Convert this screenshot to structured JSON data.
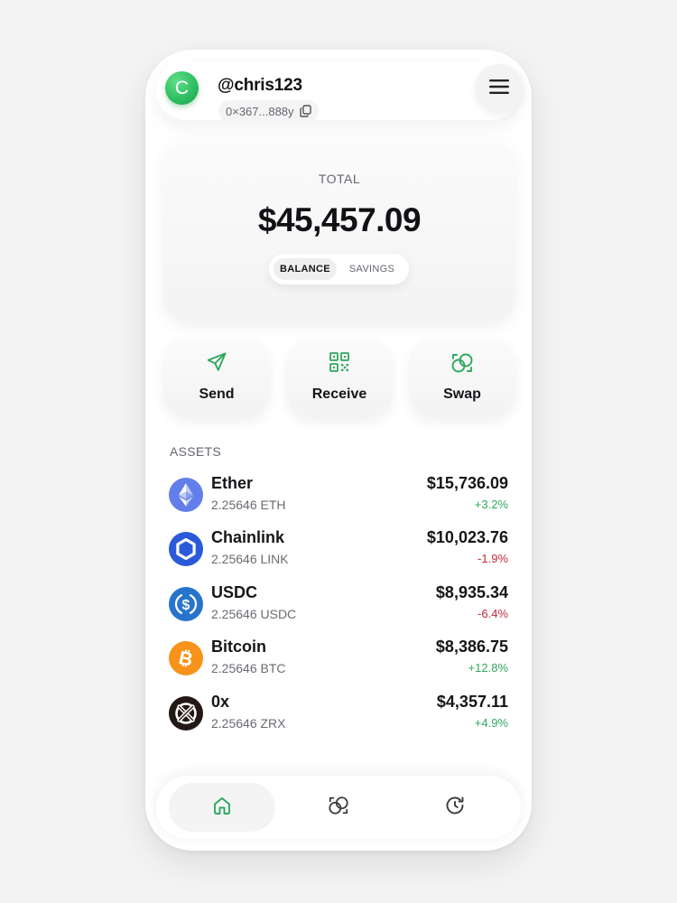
{
  "header": {
    "avatar_letter": "C",
    "username": "@chris123",
    "address": "0×367...888y"
  },
  "total": {
    "label": "TOTAL",
    "value": "$45,457.09",
    "tabs": [
      "BALANCE",
      "SAVINGS"
    ],
    "active_tab": "BALANCE"
  },
  "actions": [
    {
      "label": "Send",
      "icon": "send-icon"
    },
    {
      "label": "Receive",
      "icon": "qr-code-icon"
    },
    {
      "label": "Swap",
      "icon": "swap-icon"
    }
  ],
  "assets": {
    "heading": "ASSETS",
    "items": [
      {
        "name": "Ether",
        "amount": "2.25646 ETH",
        "value": "$15,736.09",
        "change": "+3.2%",
        "direction": "up",
        "icon": "ether-icon",
        "color": "#627eea"
      },
      {
        "name": "Chainlink",
        "amount": "2.25646 LINK",
        "value": "$10,023.76",
        "change": "-1.9%",
        "direction": "down",
        "icon": "chainlink-icon",
        "color": "#2a5ada"
      },
      {
        "name": "USDC",
        "amount": "2.25646 USDC",
        "value": "$8,935.34",
        "change": "-6.4%",
        "direction": "down",
        "icon": "usdc-icon",
        "color": "#2775ca"
      },
      {
        "name": "Bitcoin",
        "amount": "2.25646 BTC",
        "value": "$8,386.75",
        "change": "+12.8%",
        "direction": "up",
        "icon": "bitcoin-icon",
        "color": "#f7931a"
      },
      {
        "name": "0x",
        "amount": "2.25646 ZRX",
        "value": "$4,357.11",
        "change": "+4.9%",
        "direction": "up",
        "icon": "zrx-icon",
        "color": "#231815"
      }
    ]
  },
  "nav": {
    "items": [
      "home-icon",
      "swap-icon",
      "history-icon"
    ],
    "active": "home-icon"
  },
  "colors": {
    "accent_green": "#2fa85c",
    "negative_red": "#c42b3a",
    "background": "#f4f4f5"
  }
}
